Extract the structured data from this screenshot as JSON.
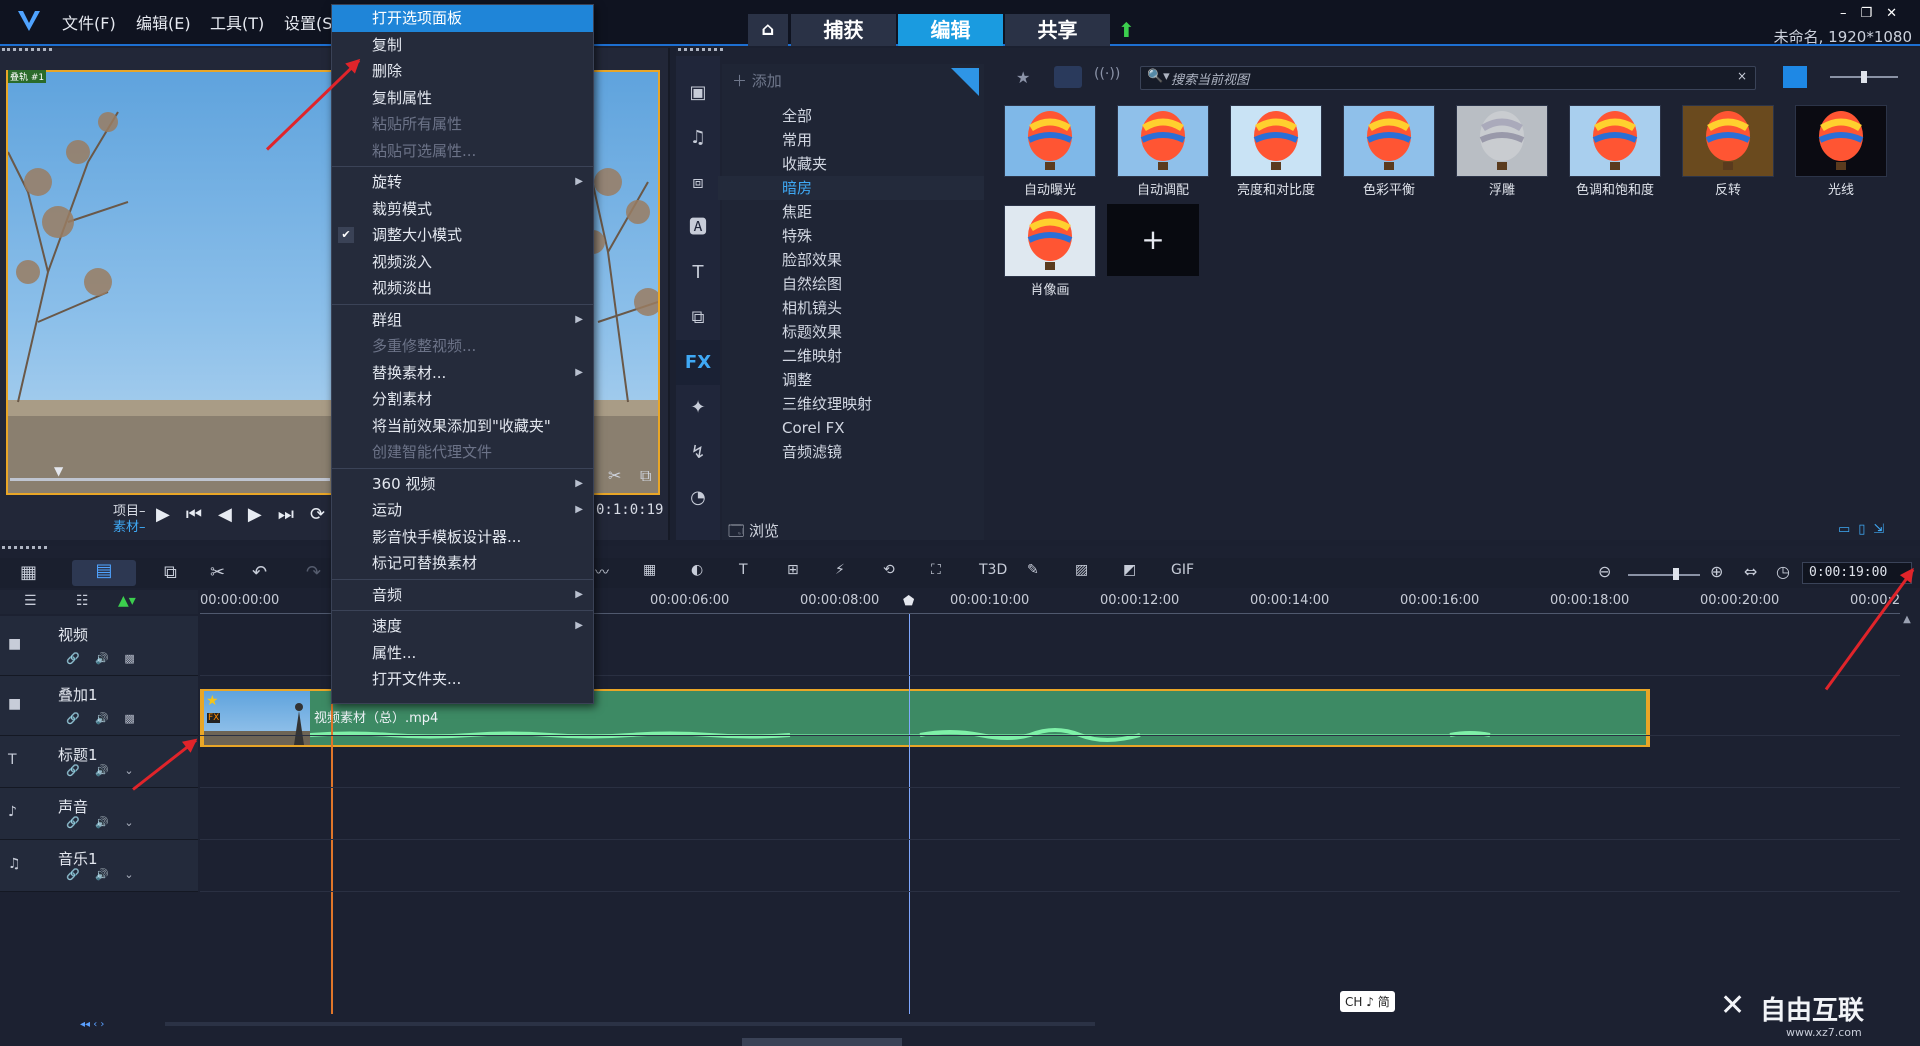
{
  "topbar": {
    "menus": [
      "文件(F)",
      "编辑(E)",
      "工具(T)",
      "设置(S"
    ],
    "tabs": [
      "捕获",
      "编辑",
      "共享"
    ],
    "active_tab": "编辑",
    "project_info": "未命名, 1920*1080"
  },
  "preview": {
    "overlay_label": "叠轨 #1",
    "mode_project": "项目",
    "mode_clip": "素材",
    "timecode": "0:1:0:19"
  },
  "context_menu": {
    "items": [
      {
        "label": "打开选项面板",
        "state": "highlight"
      },
      {
        "label": "复制"
      },
      {
        "label": "删除"
      },
      {
        "label": "复制属性"
      },
      {
        "label": "粘贴所有属性",
        "state": "disabled"
      },
      {
        "label": "粘贴可选属性...",
        "state": "disabled"
      },
      {
        "sep": true
      },
      {
        "label": "旋转",
        "submenu": true
      },
      {
        "label": "裁剪模式"
      },
      {
        "label": "调整大小模式",
        "checked": true
      },
      {
        "label": "视频淡入"
      },
      {
        "label": "视频淡出"
      },
      {
        "sep": true
      },
      {
        "label": "群组",
        "submenu": true
      },
      {
        "label": "多重修整视频...",
        "state": "disabled"
      },
      {
        "label": "替换素材...",
        "submenu": true
      },
      {
        "label": "分割素材"
      },
      {
        "label": "将当前效果添加到\"收藏夹\""
      },
      {
        "label": "创建智能代理文件",
        "state": "disabled"
      },
      {
        "sep": true
      },
      {
        "label": "360 视频",
        "submenu": true
      },
      {
        "label": "运动",
        "submenu": true
      },
      {
        "label": "影音快手模板设计器..."
      },
      {
        "label": "标记可替换素材"
      },
      {
        "sep": true
      },
      {
        "label": "音频",
        "submenu": true
      },
      {
        "sep": true
      },
      {
        "label": "速度",
        "submenu": true
      },
      {
        "label": "属性..."
      },
      {
        "label": "打开文件夹..."
      }
    ]
  },
  "library": {
    "add_label": "添加",
    "search_placeholder": "搜索当前视图",
    "browse_label": "浏览",
    "categories": [
      "全部",
      "常用",
      "收藏夹",
      "暗房",
      "焦距",
      "特殊",
      "脸部效果",
      "自然绘图",
      "相机镜头",
      "标题效果",
      "二维映射",
      "调整",
      "三维纹理映射",
      "Corel FX",
      "音频滤镜"
    ],
    "selected_category": "暗房",
    "effects": [
      "自动曝光",
      "自动调配",
      "亮度和对比度",
      "色彩平衡",
      "浮雕",
      "色调和饱和度",
      "反转",
      "光线",
      "肖像画"
    ],
    "side_icons": [
      "media-icon",
      "audio-icon",
      "transition-icon",
      "title-icon",
      "text-icon",
      "overlay-icon",
      "fx-icon",
      "magic-icon",
      "path-icon",
      "speed-icon"
    ],
    "fx_label": "FX"
  },
  "timeline": {
    "ruler": [
      "00:00:00:00",
      "00:00:06:00",
      "00:00:08:00",
      "00:00:10:00",
      "00:00:12:00",
      "00:00:14:00",
      "00:00:16:00",
      "00:00:18:00",
      "00:00:20:00",
      "00:00:2"
    ],
    "zoom_time": "0:00:19:00",
    "tracks": [
      {
        "name": "视频",
        "icon": "video-track-icon"
      },
      {
        "name": "叠加1",
        "icon": "overlay-track-icon"
      },
      {
        "name": "标题1",
        "icon": "title-track-icon"
      },
      {
        "name": "声音",
        "icon": "voice-track-icon"
      },
      {
        "name": "音乐1",
        "icon": "music-track-icon"
      }
    ],
    "clip_name": "视频素材（总）.mp4",
    "ime_badge": "CH ♪ 简"
  },
  "watermark": {
    "text": "自由互联",
    "url": "www.xz7.com"
  },
  "colors": {
    "accent": "#1a9be0",
    "clip": "#3d8a64",
    "highlight": "#1f85d8"
  }
}
